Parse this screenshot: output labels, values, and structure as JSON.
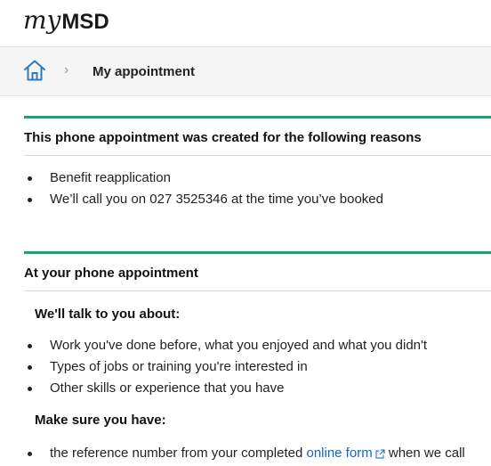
{
  "header": {
    "logo_my": "my",
    "logo_msd": "MSD"
  },
  "breadcrumb": {
    "home_icon": "home-icon",
    "separator": "›",
    "current": "My appointment"
  },
  "section1": {
    "title": "This phone appointment was created for the following reasons",
    "items": [
      "Benefit reapplication",
      "We’ll call you on 027 3525346 at the time you’ve booked"
    ]
  },
  "section2": {
    "title": "At your phone appointment",
    "talk_heading": "We'll talk to you about:",
    "talk_items": [
      "Work you've done before, what you enjoyed and what you didn't",
      "Types of jobs or training you're interested in",
      "Other skills or experience that you have"
    ],
    "have_heading": "Make sure you have:",
    "have_item_prefix": "the reference number from your completed ",
    "have_item_link": "online form",
    "have_item_suffix": " when we call"
  },
  "colors": {
    "accent": "#1aa37a",
    "link": "#1266c4",
    "home_icon": "#2a7ac0"
  }
}
